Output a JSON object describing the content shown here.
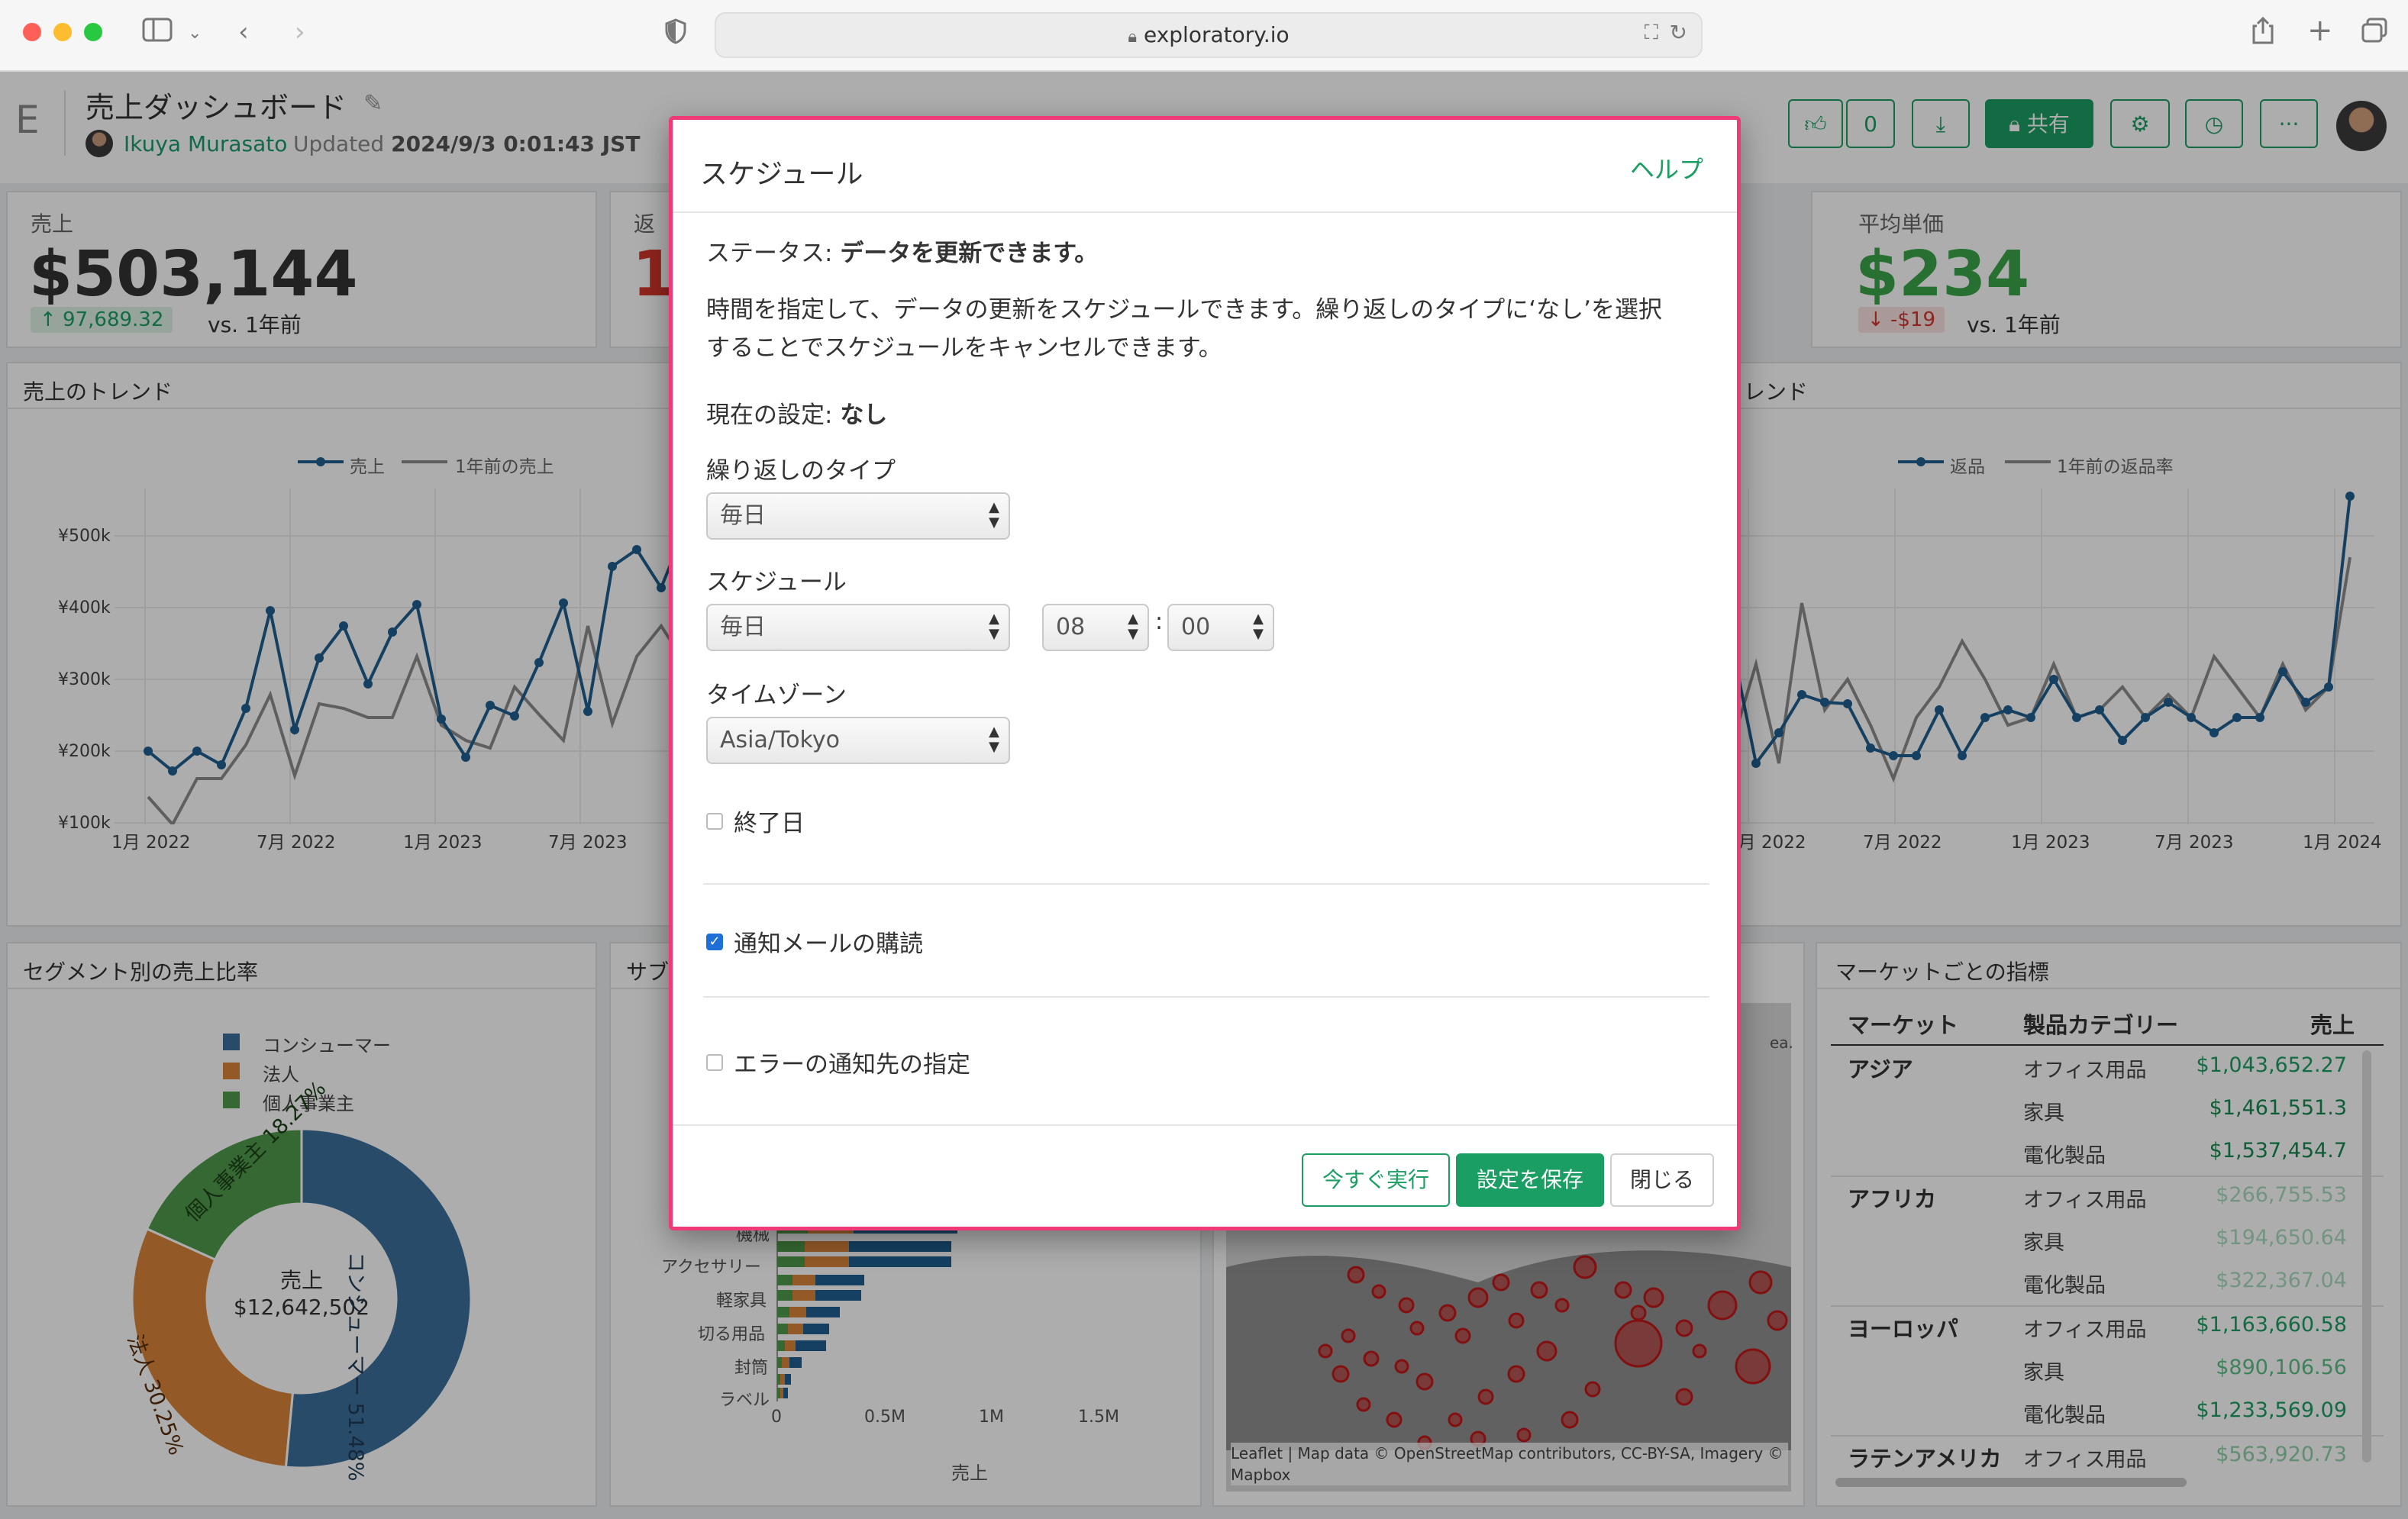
{
  "browser": {
    "url": "exploratory.io"
  },
  "dashboard": {
    "logo": "E",
    "title": "売上ダッシュボード",
    "author": "Ikuya Murasato",
    "updated_label": "Updated",
    "updated_value": "2024/9/3 0:01:43 JST",
    "like_count": "0",
    "share_label": "共有"
  },
  "kpis": {
    "sales": {
      "label": "売上",
      "value": "$503,144",
      "delta": "↑ 97,689.32",
      "vs": "vs. 1年前"
    },
    "returns": {
      "label": "返",
      "value": "1"
    },
    "avg_price": {
      "label": "平均単価",
      "value": "$234",
      "delta": "↓ -$19",
      "vs": "vs. 1年前"
    }
  },
  "trend_left": {
    "title": "売上のトレンド",
    "legend": [
      "売上",
      "1年前の売上"
    ],
    "y_ticks": [
      "¥500k",
      "¥400k",
      "¥300k",
      "¥200k",
      "¥100k"
    ],
    "x_ticks": [
      "1月 2022",
      "7月 2022",
      "1月 2023",
      "7月 2023"
    ]
  },
  "trend_right": {
    "title_fragment": "レンド",
    "legend": [
      "返品",
      "1年前の返品率"
    ],
    "x_ticks": [
      "1月 2022",
      "7月 2022",
      "1月 2023",
      "7月 2023",
      "1月 2024"
    ]
  },
  "segment": {
    "title": "セグメント別の売上比率",
    "legend": [
      "コンシューマー",
      "法人",
      "個人事業主"
    ],
    "center_label": "売上",
    "center_value": "$12,642,502",
    "slices": [
      {
        "name": "コンシューマー",
        "pct": "51.48%",
        "value": 51.48,
        "color": "#3a6f9a"
      },
      {
        "name": "法人",
        "pct": "30.25%",
        "value": 30.25,
        "color": "#d9843a"
      },
      {
        "name": "個人事業主",
        "pct": "18.27%",
        "value": 18.27,
        "color": "#4f9a4a"
      }
    ]
  },
  "sub_chart": {
    "title_fragment": "サブ",
    "categories": [
      "機械",
      "アクセサリー",
      "軽家具",
      "切る用品",
      "封筒",
      "ラベル"
    ],
    "x_ticks": [
      "0",
      "0.5M",
      "1M",
      "1.5M"
    ],
    "xlabel": "売上"
  },
  "map": {
    "fragment": "ea.",
    "attribution": "Leaflet | Map data © OpenStreetMap contributors, CC-BY-SA, Imagery © Mapbox"
  },
  "market_table": {
    "title": "マーケットごとの指標",
    "headers": [
      "マーケット",
      "製品カテゴリー",
      "売上"
    ],
    "rows": [
      {
        "market": "アジア",
        "category": "オフィス用品",
        "value": "$1,043,652.27"
      },
      {
        "market": "",
        "category": "家具",
        "value": "$1,461,551.3"
      },
      {
        "market": "",
        "category": "電化製品",
        "value": "$1,537,454.7"
      },
      {
        "market": "アフリカ",
        "category": "オフィス用品",
        "value": "$266,755.53"
      },
      {
        "market": "",
        "category": "家具",
        "value": "$194,650.64"
      },
      {
        "market": "",
        "category": "電化製品",
        "value": "$322,367.04"
      },
      {
        "market": "ヨーロッパ",
        "category": "オフィス用品",
        "value": "$1,163,660.58"
      },
      {
        "market": "",
        "category": "家具",
        "value": "$890,106.56"
      },
      {
        "market": "",
        "category": "電化製品",
        "value": "$1,233,569.09"
      },
      {
        "market": "ラテンアメリカ",
        "category": "オフィス用品",
        "value": "$563,920.73"
      }
    ]
  },
  "modal": {
    "title": "スケジュール",
    "help": "ヘルプ",
    "status_label": "ステータス:",
    "status_value": "データを更新できます。",
    "description_line1": "時間を指定して、データの更新をスケジュールできます。繰り返しのタイプに‘なし’を選択",
    "description_line2": "することでスケジュールをキャンセルできます。",
    "current_label": "現在の設定:",
    "current_value": "なし",
    "repeat_label": "繰り返しのタイプ",
    "repeat_value": "毎日",
    "schedule_label": "スケジュール",
    "schedule_value": "毎日",
    "hour_value": "08",
    "minute_value": "00",
    "time_sep": ":",
    "timezone_label": "タイムゾーン",
    "timezone_value": "Asia/Tokyo",
    "end_date_label": "終了日",
    "end_date_checked": false,
    "notify_label": "通知メールの購読",
    "notify_checked": true,
    "error_notify_label": "エラーの通知先の指定",
    "error_notify_checked": false,
    "run_now": "今すぐ実行",
    "save": "設定を保存",
    "close": "閉じる"
  },
  "colors": {
    "accent": "#1b9e63",
    "modal_border": "#ee3b77",
    "series_blue": "#1f5f8f",
    "series_gray": "#8c8c8c"
  }
}
